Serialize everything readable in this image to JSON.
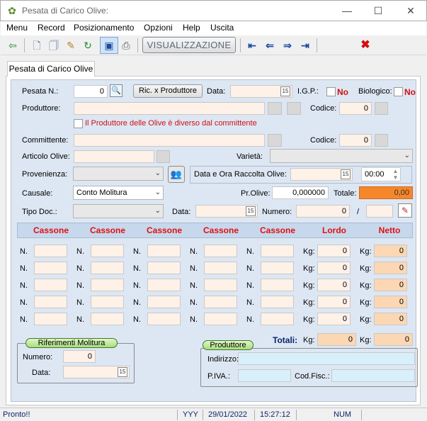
{
  "window": {
    "title": "Pesata di Carico Olive:",
    "minimize": "—",
    "maximize": "☐",
    "close": "✕"
  },
  "menu": [
    "Menu",
    "Record",
    "Posizionamento",
    "Opzioni",
    "Help",
    "Uscita"
  ],
  "toolbar": {
    "vis_label": "VISUALIZZAZIONE"
  },
  "tab": {
    "label": "Pesata di Carico Olive"
  },
  "form": {
    "pesata_label": "Pesata N.:",
    "pesata_value": "0",
    "ric_button": "Ric. x Produttore",
    "data_label": "Data:",
    "igp_label": "I.G.P.:",
    "igp_value": "No",
    "bio_label": "Biologico:",
    "bio_value": "No",
    "produttore_label": "Produttore:",
    "codice_label": "Codice:",
    "codice_prod_value": "0",
    "diverso_label": "Il Produttore delle Olive è diverso dal committente",
    "committente_label": "Committente:",
    "codice_comm_value": "0",
    "articolo_label": "Articolo Olive:",
    "varieta_label": "Varietà:",
    "provenienza_label": "Provenienza:",
    "raccolta_label": "Data e Ora Raccolta Olive:",
    "ora_value": "00:00",
    "causale_label": "Causale:",
    "causale_value": "Conto Molitura",
    "prolive_label": "Pr.Olive:",
    "prolive_value": "0,000000",
    "totale_label": "Totale:",
    "totale_value": "0,00",
    "tipodoc_label": "Tipo Doc.:",
    "data2_label": "Data:",
    "numero_label": "Numero:",
    "numero_value": "0",
    "slash": "/"
  },
  "grid": {
    "headers": [
      "Cassone",
      "Cassone",
      "Cassone",
      "Cassone",
      "Cassone",
      "Lordo",
      "Netto"
    ],
    "n_label": "N.",
    "kg_label": "Kg:",
    "row_value": "0",
    "rows": 5,
    "totali_label": "Totali:",
    "tot_lordo": "0",
    "tot_netto": "0"
  },
  "riferimenti": {
    "title": "Riferimenti Molitura",
    "numero_label": "Numero:",
    "numero_value": "0",
    "data_label": "Data:"
  },
  "produttore_box": {
    "title": "Produttore",
    "indirizzo_label": "Indirizzo:",
    "piva_label": "P.IVA.:",
    "codfisc_label": "Cod.Fisc.:"
  },
  "status": {
    "text": "Pronto!!",
    "year_mode": "YYY",
    "date": "29/01/2022",
    "time": "15:27:12",
    "num": "NUM"
  },
  "colors": {
    "accent_red": "#e01010",
    "total_orange": "#f6862a",
    "panel_blue": "#dde7f3"
  }
}
